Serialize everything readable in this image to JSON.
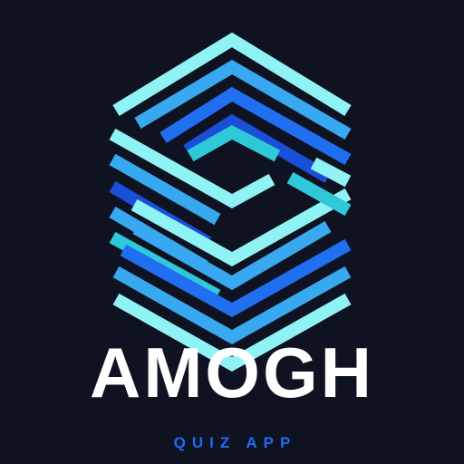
{
  "brand": {
    "title": "AMOGH",
    "subtitle": "QUIZ APP"
  },
  "logo": {
    "icon": "hexagon-stripes-logo-icon",
    "colors": {
      "cyan_light": "#8ff3f5",
      "cyan": "#2fc8d8",
      "sky": "#38a8f0",
      "blue": "#1f6ff0",
      "deep_blue": "#1a4fd8"
    }
  },
  "colors": {
    "background": "#0f1220",
    "title": "#ffffff",
    "subtitle": "#1e6cf5"
  }
}
